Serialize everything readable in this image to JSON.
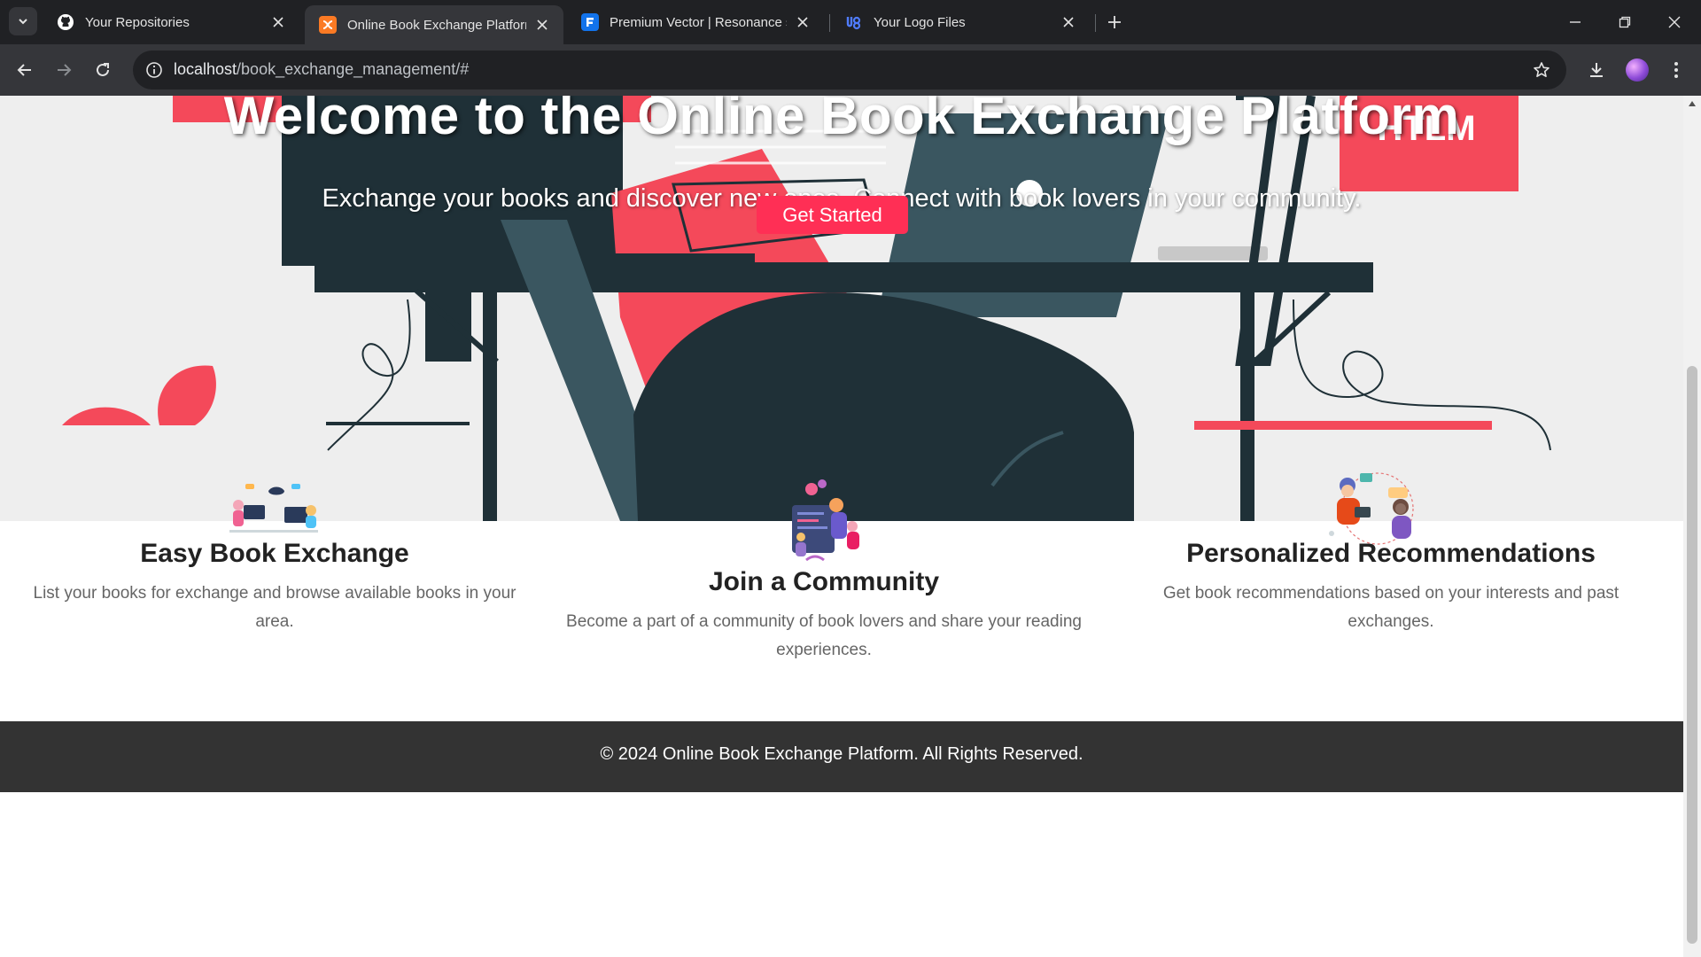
{
  "browser": {
    "tabs": [
      {
        "title": "Your Repositories",
        "icon": "github-icon"
      },
      {
        "title": "Online Book Exchange Platform",
        "icon": "xampp-icon"
      },
      {
        "title": "Premium Vector | Resonance sound",
        "icon": "freepik-icon"
      },
      {
        "title": "Your Logo Files",
        "icon": "logo-files-icon"
      }
    ],
    "url_host": "localhost",
    "url_path": "/book_exchange_management/#"
  },
  "hero": {
    "title": "Welcome to the Online Book Exchange Platform",
    "subtitle": "Exchange your books and discover new ones. Connect with book lovers in your community.",
    "cta_label": "Get Started",
    "background_art_text": "HTLM"
  },
  "features": [
    {
      "title": "Easy Book Exchange",
      "description": "List your books for exchange and browse available books in your area.",
      "icon": "book-exchange-illustration"
    },
    {
      "title": "Join a Community",
      "description": "Become a part of a community of book lovers and share your reading experiences.",
      "icon": "community-illustration"
    },
    {
      "title": "Personalized Recommendations",
      "description": "Get book recommendations based on your interests and past exchanges.",
      "icon": "recommendations-illustration"
    }
  ],
  "footer": {
    "text": "© 2024 Online Book Exchange Platform. All Rights Reserved."
  },
  "colors": {
    "accent": "#ff2f55",
    "footer_bg": "#333333",
    "chrome_dark": "#202124",
    "chrome_toolbar": "#35363a"
  }
}
